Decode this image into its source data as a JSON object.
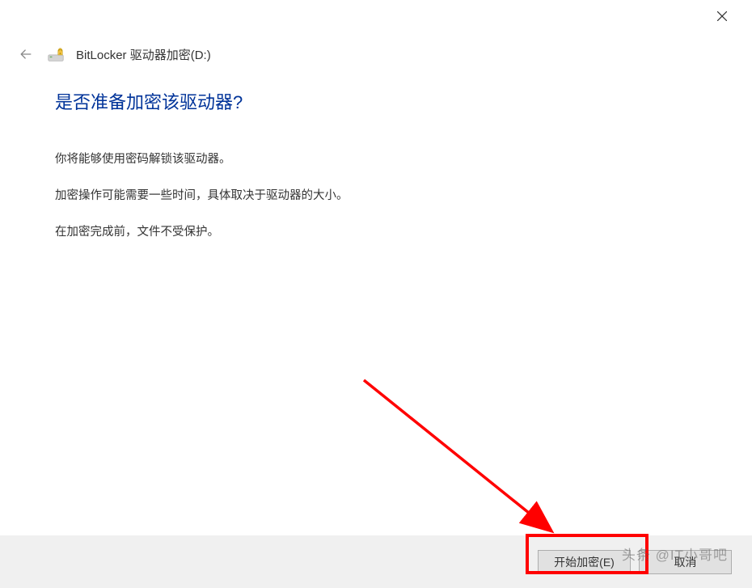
{
  "titlebar": {
    "close_label": "Close"
  },
  "header": {
    "back_label": "Back",
    "icon_name": "bitlocker-drive-icon",
    "title": "BitLocker 驱动器加密(D:)"
  },
  "content": {
    "heading": "是否准备加密该驱动器?",
    "line1": "你将能够使用密码解锁该驱动器。",
    "line2": "加密操作可能需要一些时间，具体取决于驱动器的大小。",
    "line3": "在加密完成前，文件不受保护。"
  },
  "footer": {
    "start_encrypt_label": "开始加密(E)",
    "cancel_label": "取消"
  },
  "watermark": {
    "text": "头条 @IT小哥吧"
  }
}
